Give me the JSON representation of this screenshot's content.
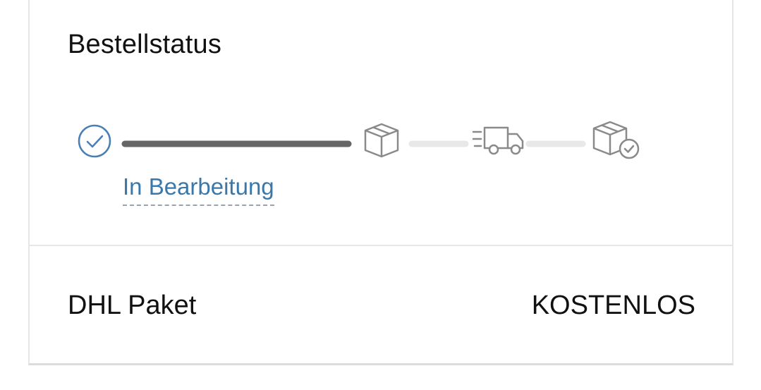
{
  "order_status": {
    "title": "Bestellstatus",
    "current_step_label": "In Bearbeitung",
    "steps": [
      {
        "icon": "check-circle-icon",
        "state": "completed"
      },
      {
        "icon": "package-icon",
        "state": "pending"
      },
      {
        "icon": "delivery-truck-icon",
        "state": "pending"
      },
      {
        "icon": "package-delivered-icon",
        "state": "pending"
      }
    ],
    "colors": {
      "active": "#4a7fb5",
      "progress_done": "#666666",
      "progress_pending": "#e8e8e8",
      "icon_pending": "#8a8a8a"
    }
  },
  "shipping": {
    "method": "DHL Paket",
    "price": "KOSTENLOS"
  }
}
